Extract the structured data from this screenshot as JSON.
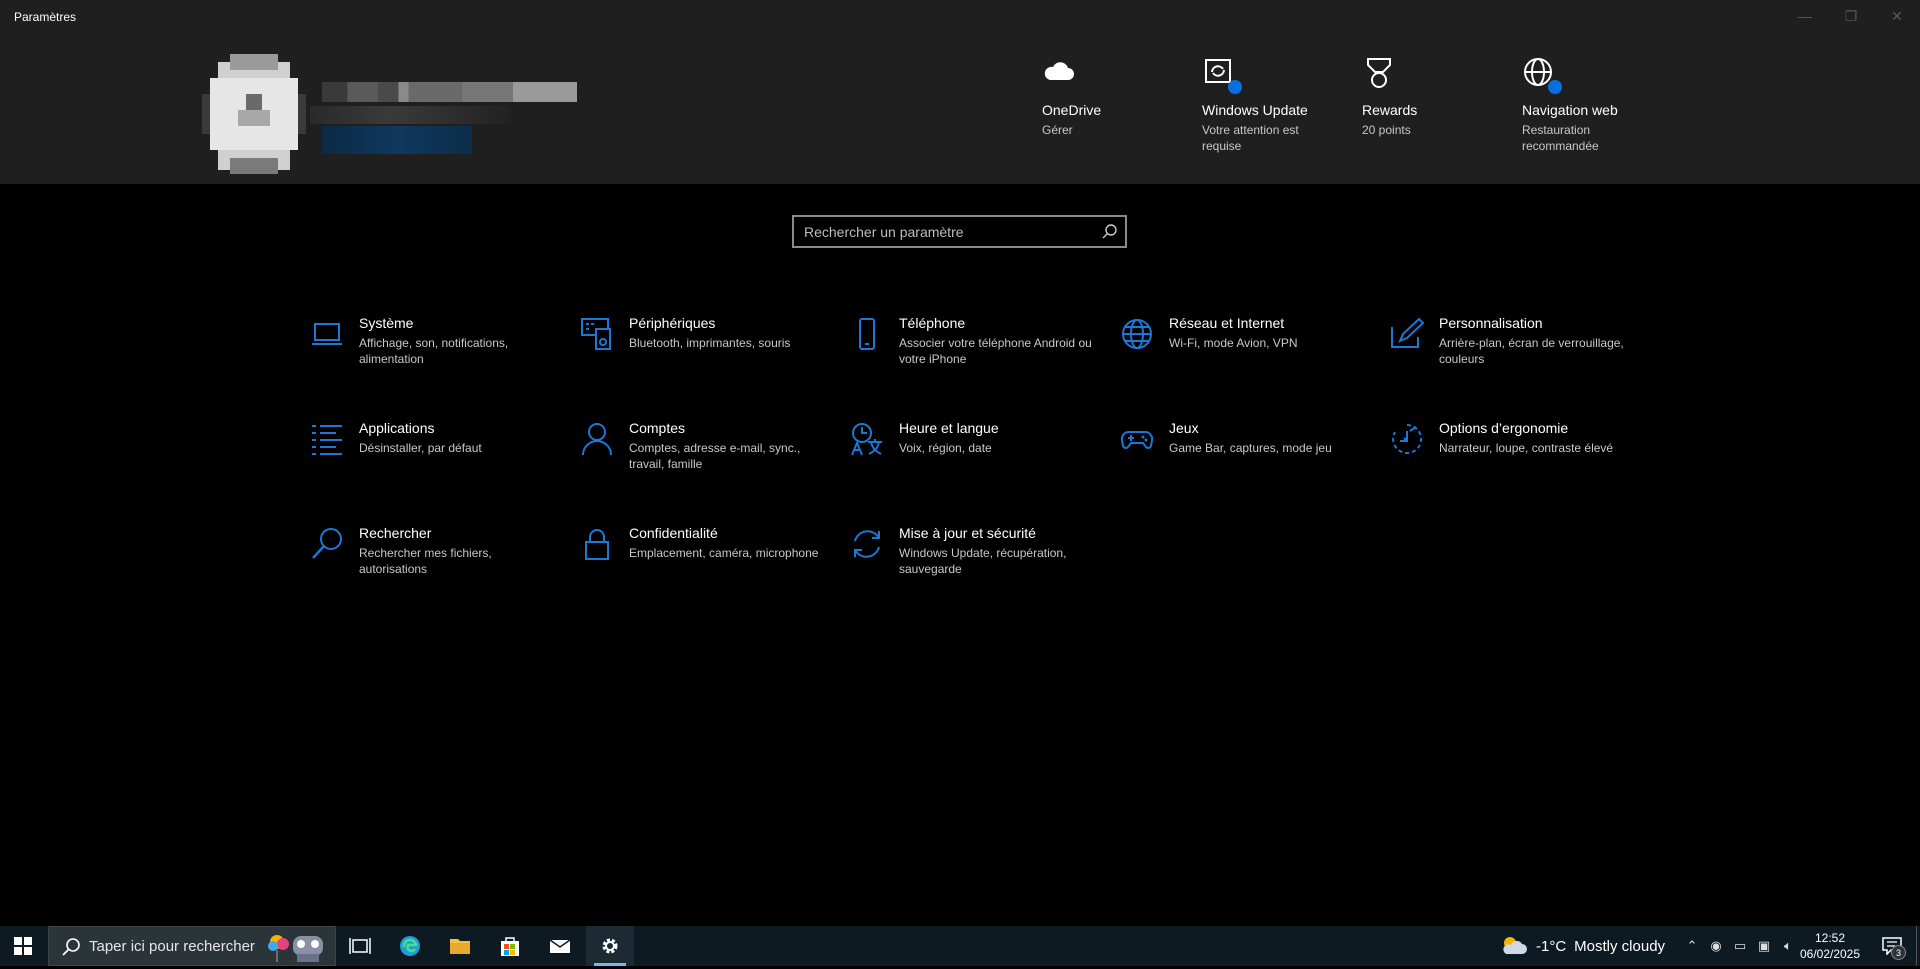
{
  "window": {
    "title": "Paramètres"
  },
  "controls": {
    "minimize": "—",
    "restore": "❐",
    "close": "✕"
  },
  "header": {
    "items": [
      {
        "title": "OneDrive",
        "sub": "Gérer",
        "icon": "cloud-icon"
      },
      {
        "title": "Windows Update",
        "sub": "Votre attention est requise",
        "icon": "windows-update-icon"
      },
      {
        "title": "Rewards",
        "sub": "20 points",
        "icon": "medal-icon"
      },
      {
        "title": "Navigation web",
        "sub": "Restauration recommandée",
        "icon": "globe-icon"
      }
    ]
  },
  "search": {
    "placeholder": "Rechercher un paramètre"
  },
  "tiles": [
    {
      "title": "Système",
      "sub": "Affichage, son, notifications, alimentation",
      "icon": "laptop-icon"
    },
    {
      "title": "Périphériques",
      "sub": "Bluetooth, imprimantes, souris",
      "icon": "devices-icon"
    },
    {
      "title": "Téléphone",
      "sub": "Associer votre téléphone Android ou votre iPhone",
      "icon": "phone-icon"
    },
    {
      "title": "Réseau et Internet",
      "sub": "Wi-Fi, mode Avion, VPN",
      "icon": "globe-icon"
    },
    {
      "title": "Personnalisation",
      "sub": "Arrière-plan, écran de verrouillage, couleurs",
      "icon": "pen-screen-icon"
    },
    {
      "title": "Applications",
      "sub": "Désinstaller, par défaut",
      "icon": "apps-list-icon"
    },
    {
      "title": "Comptes",
      "sub": "Comptes, adresse e-mail, sync., travail, famille",
      "icon": "person-icon"
    },
    {
      "title": "Heure et langue",
      "sub": "Voix, région, date",
      "icon": "time-language-icon"
    },
    {
      "title": "Jeux",
      "sub": "Game Bar, captures, mode jeu",
      "icon": "gamepad-icon"
    },
    {
      "title": "Options d’ergonomie",
      "sub": "Narrateur, loupe, contraste élevé",
      "icon": "ease-of-access-icon"
    },
    {
      "title": "Rechercher",
      "sub": "Rechercher mes fichiers, autorisations",
      "icon": "search-icon"
    },
    {
      "title": "Confidentialité",
      "sub": "Emplacement, caméra, microphone",
      "icon": "lock-icon"
    },
    {
      "title": "Mise à jour et sécurité",
      "sub": "Windows Update, récupération, sauvegarde",
      "icon": "sync-icon"
    }
  ],
  "taskbar": {
    "search_placeholder": "Taper ici pour rechercher",
    "weather_temp": "-1°C",
    "weather_text": "Mostly cloudy",
    "time": "12:52",
    "date": "06/02/2025",
    "notif_count": "3"
  },
  "colors": {
    "accent": "#1a78d6",
    "header_bg": "#1f1f1f",
    "taskbar_bg": "#0e1a22"
  }
}
